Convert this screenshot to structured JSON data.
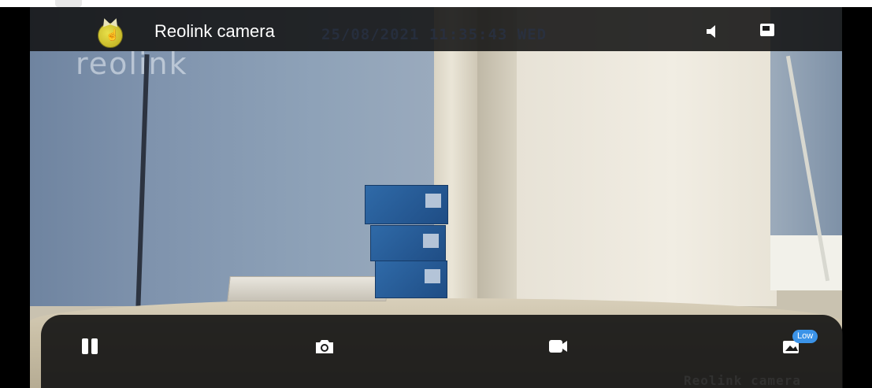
{
  "topbar": {
    "camera_name": "Reolink camera",
    "osd_timestamp": "25/08/2021 11:35:43 WED",
    "logo_icon": "reolink-cat-icon",
    "speaker_icon": "speaker-icon",
    "pip_icon": "picture-in-picture-icon"
  },
  "video": {
    "watermark": "reolink",
    "osd_name": "Reolink camera"
  },
  "controls": {
    "pause_icon": "pause-icon",
    "snapshot_icon": "camera-icon",
    "record_icon": "video-record-icon",
    "quality_icon": "image-quality-icon",
    "quality_badge": "Low",
    "badge_color": "#3b93e8"
  }
}
